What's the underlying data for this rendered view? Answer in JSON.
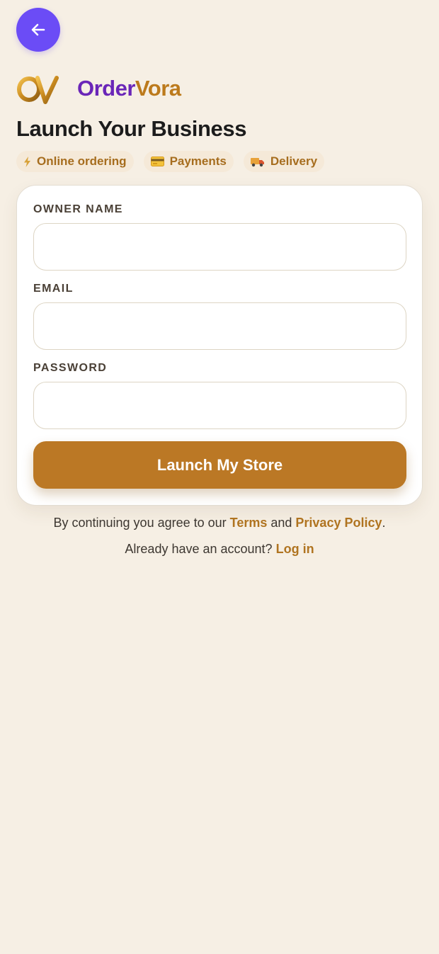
{
  "header": {
    "back_icon": "arrow-left-icon",
    "accent_color": "#6b4cf6"
  },
  "brand": {
    "name_part1": "Order",
    "name_part2": "Vora",
    "color_part1": "#6a25b8",
    "color_part2": "#bc7a1c"
  },
  "page_title": "Launch Your Business",
  "features": [
    {
      "icon": "lightning-icon",
      "label": "Online ordering"
    },
    {
      "icon": "credit-card-icon",
      "label": "Payments"
    },
    {
      "icon": "delivery-truck-icon",
      "label": "Delivery"
    }
  ],
  "form": {
    "owner_name_label": "OWNER NAME",
    "owner_name_value": "",
    "email_label": "EMAIL",
    "email_value": "",
    "password_label": "PASSWORD",
    "password_value": "",
    "submit_label": "Launch My Store",
    "submit_color": "#bb7825"
  },
  "footer": {
    "legal_prefix": "By continuing you agree to our ",
    "terms_link": "Terms",
    "legal_and": " and ",
    "privacy_link": "Privacy Policy",
    "legal_suffix": ".",
    "login_prompt": "Already have an account? ",
    "login_link": "Log in"
  }
}
